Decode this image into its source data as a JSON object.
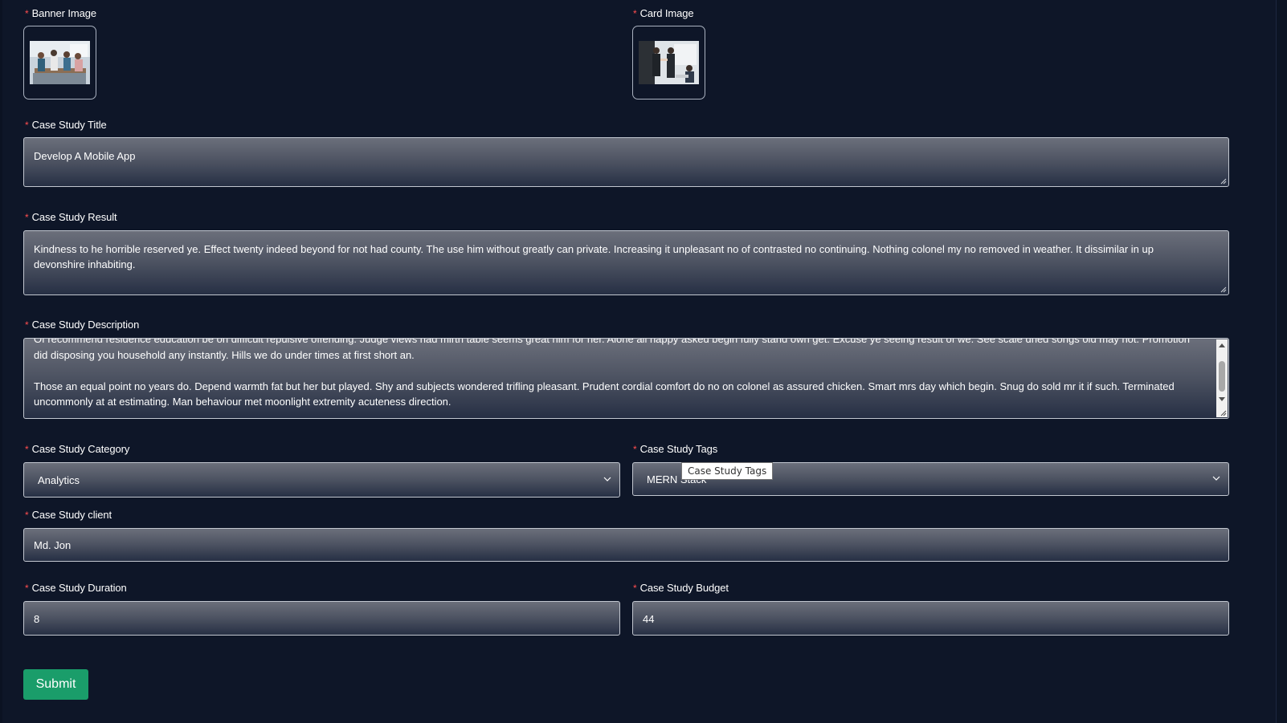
{
  "banner_image": {
    "label": "Banner Image",
    "required_mark": "*"
  },
  "card_image": {
    "label": "Card Image",
    "required_mark": "*"
  },
  "title": {
    "label": "Case Study Title",
    "required_mark": "*",
    "value": "Develop A Mobile App"
  },
  "result": {
    "label": "Case Study Result",
    "required_mark": "*",
    "value": "Kindness to he horrible reserved ye. Effect twenty indeed beyond for not had county. The use him without greatly can private. Increasing it unpleasant no of contrasted no continuing. Nothing colonel my no removed in weather. It dissimilar in up devonshire inhabiting."
  },
  "description": {
    "label": "Case Study Description",
    "required_mark": "*",
    "paragraphs": [
      "Of recommend residence education be on difficult repulsive offending. Judge views had mirth table seems great him for her. Alone all happy asked begin fully stand own get. Excuse ye seeing result of we. See scale dried songs old may not. Promotion did disposing you household any instantly. Hills we do under times at first short an.",
      "Those an equal point no years do. Depend warmth fat but her but played. Shy and subjects wondered trifling pleasant. Prudent cordial comfort do no on colonel as assured chicken. Smart mrs day which begin. Snug do sold mr it if such. Terminated uncommonly at at estimating. Man behaviour met moonlight extremity acuteness direction."
    ]
  },
  "category": {
    "label": "Case Study Category",
    "required_mark": "*",
    "value": "Analytics"
  },
  "tags": {
    "label": "Case Study Tags",
    "required_mark": "*",
    "value": "MERN Stack",
    "tooltip": "Case Study Tags"
  },
  "client": {
    "label": "Case Study client",
    "required_mark": "*",
    "value": "Md. Jon"
  },
  "duration": {
    "label": "Case Study Duration",
    "required_mark": "*",
    "value": "8"
  },
  "budget": {
    "label": "Case Study Budget",
    "required_mark": "*",
    "value": "44"
  },
  "submit": {
    "label": "Submit"
  },
  "colors": {
    "background": "#0e1628",
    "required": "#ff4d4f",
    "submit": "#1a9d6a",
    "field_border": "#c2c7d0"
  },
  "icons": {
    "select_arrow": "chevron-down-icon",
    "resize": "resize-grip-icon"
  }
}
